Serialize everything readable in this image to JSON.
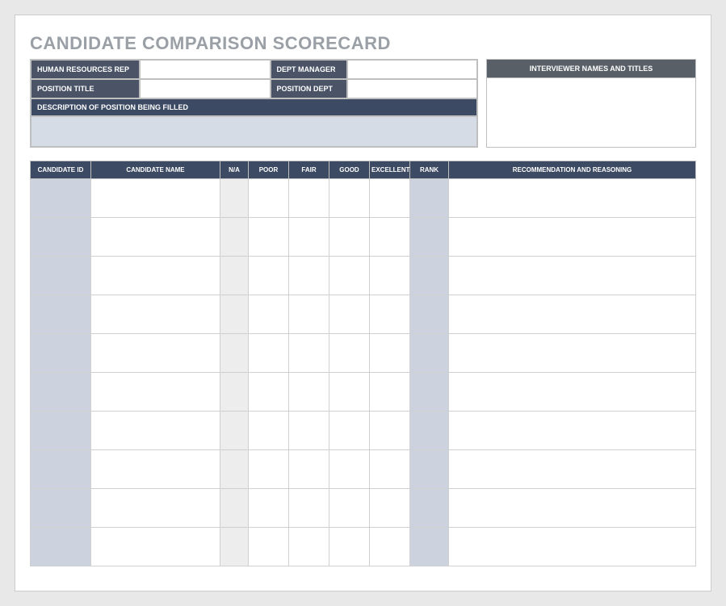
{
  "title": "CANDIDATE COMPARISON SCORECARD",
  "top": {
    "hr_rep_label": "HUMAN RESOURCES REP",
    "hr_rep_value": "",
    "dept_manager_label": "DEPT MANAGER",
    "dept_manager_value": "",
    "position_title_label": "POSITION TITLE",
    "position_title_value": "",
    "position_dept_label": "POSITION DEPT",
    "position_dept_value": "",
    "description_label": "DESCRIPTION OF POSITION BEING FILLED",
    "description_value": "",
    "interviewer_header": "INTERVIEWER NAMES AND TITLES",
    "interviewer_value": ""
  },
  "table": {
    "headers": {
      "candidate_id": "CANDIDATE ID",
      "candidate_name": "CANDIDATE NAME",
      "na": "N/A",
      "poor": "POOR",
      "fair": "FAIR",
      "good": "GOOD",
      "excellent": "EXCELLENT",
      "rank": "RANK",
      "recommendation": "RECOMMENDATION AND REASONING"
    },
    "rows": [
      {
        "id": "",
        "name": "",
        "na": "",
        "poor": "",
        "fair": "",
        "good": "",
        "excellent": "",
        "rank": "",
        "rec": ""
      },
      {
        "id": "",
        "name": "",
        "na": "",
        "poor": "",
        "fair": "",
        "good": "",
        "excellent": "",
        "rank": "",
        "rec": ""
      },
      {
        "id": "",
        "name": "",
        "na": "",
        "poor": "",
        "fair": "",
        "good": "",
        "excellent": "",
        "rank": "",
        "rec": ""
      },
      {
        "id": "",
        "name": "",
        "na": "",
        "poor": "",
        "fair": "",
        "good": "",
        "excellent": "",
        "rank": "",
        "rec": ""
      },
      {
        "id": "",
        "name": "",
        "na": "",
        "poor": "",
        "fair": "",
        "good": "",
        "excellent": "",
        "rank": "",
        "rec": ""
      },
      {
        "id": "",
        "name": "",
        "na": "",
        "poor": "",
        "fair": "",
        "good": "",
        "excellent": "",
        "rank": "",
        "rec": ""
      },
      {
        "id": "",
        "name": "",
        "na": "",
        "poor": "",
        "fair": "",
        "good": "",
        "excellent": "",
        "rank": "",
        "rec": ""
      },
      {
        "id": "",
        "name": "",
        "na": "",
        "poor": "",
        "fair": "",
        "good": "",
        "excellent": "",
        "rank": "",
        "rec": ""
      },
      {
        "id": "",
        "name": "",
        "na": "",
        "poor": "",
        "fair": "",
        "good": "",
        "excellent": "",
        "rank": "",
        "rec": ""
      },
      {
        "id": "",
        "name": "",
        "na": "",
        "poor": "",
        "fair": "",
        "good": "",
        "excellent": "",
        "rank": "",
        "rec": ""
      }
    ]
  }
}
